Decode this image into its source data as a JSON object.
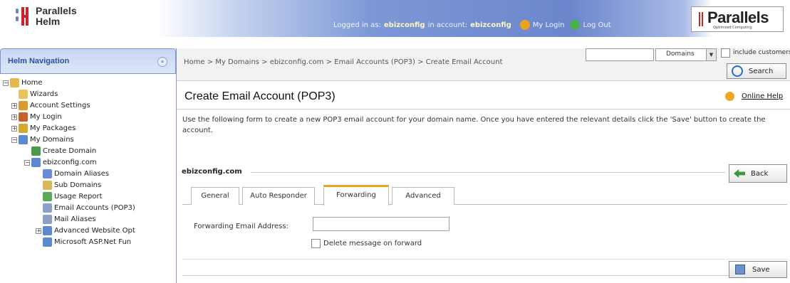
{
  "header": {
    "logo_line1": "Parallels",
    "logo_line2": "Helm",
    "logged_in_prefix": "Logged in as:",
    "logged_in_user": "ebizconfig",
    "account_prefix": "in account:",
    "account_name": "ebizconfig",
    "my_login_label": "My Login",
    "log_out_label": "Log Out",
    "brand_word": "Parallels",
    "brand_tagline": "Optimized Computing"
  },
  "nav": {
    "title": "Helm Navigation",
    "collapse_glyph": "«",
    "items": [
      {
        "label": "Home"
      },
      {
        "label": "Wizards"
      },
      {
        "label": "Account Settings"
      },
      {
        "label": "My Login"
      },
      {
        "label": "My Packages"
      },
      {
        "label": "My Domains"
      },
      {
        "label": "Create Domain"
      },
      {
        "label": "ebizconfig.com"
      },
      {
        "label": "Domain Aliases"
      },
      {
        "label": "Sub Domains"
      },
      {
        "label": "Usage Report"
      },
      {
        "label": "Email Accounts (POP3)"
      },
      {
        "label": "Mail Aliases"
      },
      {
        "label": "Advanced Website Opt"
      },
      {
        "label": "Microsoft ASP.Net Fun"
      }
    ]
  },
  "breadcrumb": "Home > My Domains > ebizconfig.com > Email Accounts (POP3) > Create Email Account",
  "search": {
    "value": "",
    "scope_selected": "Domains",
    "include_label": "include customers",
    "button_label": "Search"
  },
  "page": {
    "title": "Create Email Account (POP3)",
    "help_label": "Online Help",
    "intro": "Use the following form to create a new POP3 email account for your domain name. Once you have entered the relevant details click the 'Save' button to create the account.",
    "section_label": "ebizconfig.com",
    "back_label": "Back",
    "save_label": "Save"
  },
  "tabs": [
    {
      "label": "General",
      "active": false
    },
    {
      "label": "Auto Responder",
      "active": false
    },
    {
      "label": "Forwarding",
      "active": true
    },
    {
      "label": "Advanced",
      "active": false
    }
  ],
  "form": {
    "forward_label": "Forwarding Email Address:",
    "forward_value": "",
    "delete_label": "Delete message on forward",
    "delete_checked": false
  },
  "colors": {
    "accent_tab": "#f0a020",
    "nav_header": "#c9d6f2",
    "brand_red": "#c8262c"
  }
}
